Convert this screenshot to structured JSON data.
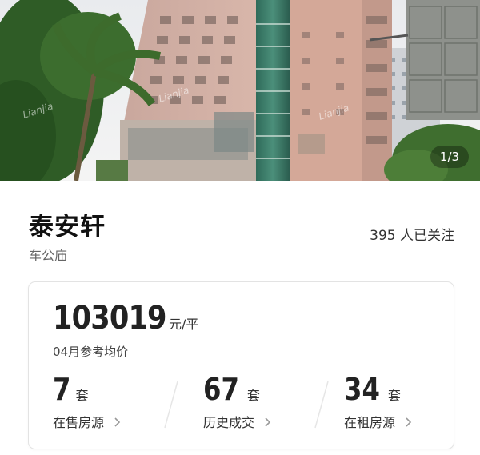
{
  "hero": {
    "pager": "1/3",
    "watermarks": [
      "Lianjia",
      "Lianjia",
      "Lianjia"
    ]
  },
  "community": {
    "name": "泰安轩",
    "district": "车公庙",
    "followers": "395 人已关注"
  },
  "price_card": {
    "price": "103019",
    "unit": "元/平",
    "note": "04月参考均价"
  },
  "stats": [
    {
      "value": "7",
      "unit": "套",
      "label": "在售房源",
      "icon": "chevron-right-icon"
    },
    {
      "value": "67",
      "unit": "套",
      "label": "历史成交",
      "icon": "chevron-right-icon"
    },
    {
      "value": "34",
      "unit": "套",
      "label": "在租房源",
      "icon": "chevron-right-icon"
    }
  ],
  "colors": {
    "card_border": "#e3e3e3",
    "text_primary": "#222222",
    "text_secondary": "#666666",
    "chevron": "#999999"
  }
}
